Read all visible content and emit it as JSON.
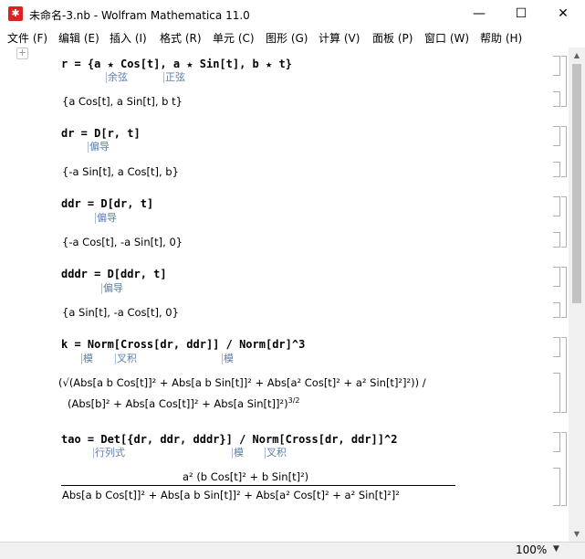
{
  "window": {
    "title": "未命名-3.nb - Wolfram Mathematica 11.0",
    "minimize": "—",
    "maximize": "☐",
    "close": "✕"
  },
  "menu": [
    "文件 (F)",
    "编辑 (E)",
    "插入 (I)",
    "格式 (R)",
    "单元 (C)",
    "图形 (G)",
    "计算 (V)",
    "面板 (P)",
    "窗口 (W)",
    "帮助 (H)"
  ],
  "cells": {
    "c1_in_pre": "r = {a ",
    "c1_in_a": "★",
    "c1_in_mid": " Cos[t], a ",
    "c1_in_rest": " Sin[t], b ",
    "c1_in_end": " t}",
    "c1_hint1": "余弦",
    "c1_hint2": "正弦",
    "c1_out": "{a Cos[t], a Sin[t], b t}",
    "c2_in": "dr = D[r, t]",
    "c2_hint": "偏导",
    "c2_out": "{-a Sin[t], a Cos[t], b}",
    "c3_in": "ddr = D[dr, t]",
    "c3_hint": "偏导",
    "c3_out": "{-a Cos[t], -a Sin[t], 0}",
    "c4_in": "dddr = D[ddr, t]",
    "c4_hint": "偏导",
    "c4_out": "{a Sin[t], -a Cos[t], 0}",
    "c5_in": "k = Norm[Cross[dr, ddr]] / Norm[dr]^3",
    "c5_hint1": "模",
    "c5_hint2": "叉积",
    "c5_hint3": "模",
    "c5_out1": "(√(Abs[a b Cos[t]]² + Abs[a b Sin[t]]² + Abs[a² Cos[t]² + a² Sin[t]²]²)) /",
    "c5_out2": "(Abs[b]² + Abs[a Cos[t]]² + Abs[a Sin[t]]²)",
    "c5_out2_exp": "3/2",
    "c6_in": "tao = Det[{dr, ddr, dddr}] / Norm[Cross[dr, ddr]]^2",
    "c6_hint1": "行列式",
    "c6_hint2": "模",
    "c6_hint3": "叉积",
    "c6_num": "a² (b Cos[t]² + b Sin[t]²)",
    "c6_den": "Abs[a b Cos[t]]² + Abs[a b Sin[t]]² + Abs[a² Cos[t]² + a² Sin[t]²]²"
  },
  "status": {
    "zoom": "100%"
  },
  "colors": {
    "symbol_blue": "#2a3fb0",
    "hint_blue": "#5f7fa8",
    "bracket_gray": "#b0b0b0"
  }
}
